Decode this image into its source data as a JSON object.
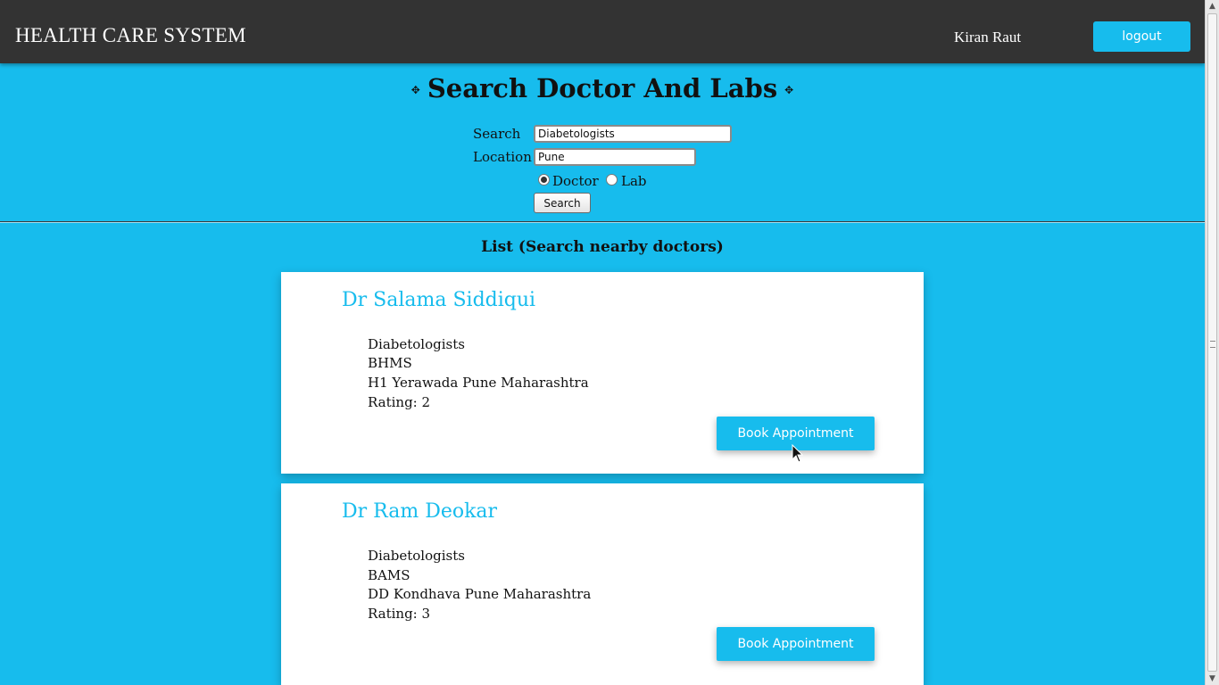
{
  "header": {
    "brand": "HEALTH CARE SYSTEM",
    "user_name": "Kiran Raut",
    "logout_label": "logout"
  },
  "search_form": {
    "title": "Search Doctor And Labs",
    "search_label": "Search",
    "search_value": "Diabetologists",
    "location_label": "Location",
    "location_value": "Pune",
    "type_options": [
      {
        "label": "Doctor",
        "selected": true
      },
      {
        "label": "Lab",
        "selected": false
      }
    ],
    "search_button": "Search"
  },
  "results": {
    "heading": "List (Search nearby doctors)",
    "book_label": "Book Appointment",
    "doctors": [
      {
        "name": "Dr Salama Siddiqui",
        "specialty": "Diabetologists",
        "degree": "BHMS",
        "address": "H1 Yerawada Pune Maharashtra",
        "rating": "Rating: 2"
      },
      {
        "name": "Dr Ram Deokar",
        "specialty": "Diabetologists",
        "degree": "BAMS",
        "address": "DD Kondhava Pune Maharashtra",
        "rating": "Rating: 3"
      }
    ]
  },
  "colors": {
    "background": "#17bced",
    "header": "#333333",
    "accent": "#17bced"
  }
}
